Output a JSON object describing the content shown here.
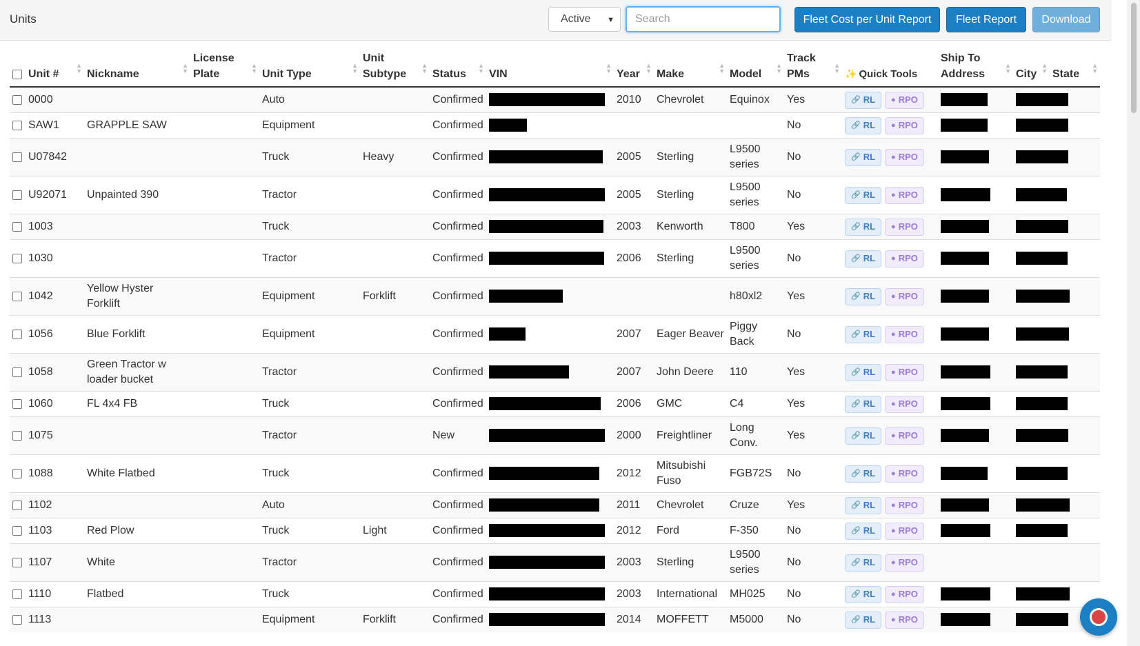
{
  "header": {
    "title": "Units",
    "status_filter": "Active",
    "search_placeholder": "Search",
    "buttons": {
      "fleet_cost": "Fleet Cost per Unit Report",
      "fleet_report": "Fleet Report",
      "download": "Download"
    }
  },
  "table": {
    "columns": {
      "unit": "Unit #",
      "nickname": "Nickname",
      "license_1": "License",
      "license_2": "Plate",
      "unit_type": "Unit Type",
      "subtype_1": "Unit",
      "subtype_2": "Subtype",
      "status": "Status",
      "vin": "VIN",
      "year": "Year",
      "make": "Make",
      "model": "Model",
      "track_1": "Track",
      "track_2": "PMs",
      "quick_tools": "Quick Tools",
      "ship_1": "Ship To",
      "ship_2": "Address",
      "city": "City",
      "state": "State"
    },
    "quick_tool_labels": {
      "rl": "RL",
      "rpo": "RPO"
    },
    "rows": [
      {
        "unit": "0000",
        "nickname": "",
        "unit_type": "Auto",
        "subtype": "",
        "status": "Confirmed",
        "vin_w": 168,
        "year": "2010",
        "make": "Chevrolet",
        "model": "Equinox",
        "track": "Yes",
        "tools": true,
        "ship_w": 68,
        "city_w": 76
      },
      {
        "unit": "SAW1",
        "nickname": "GRAPPLE SAW",
        "unit_type": "Equipment",
        "subtype": "",
        "status": "Confirmed",
        "vin_w": 55,
        "year": "",
        "make": "",
        "model": "",
        "track": "No",
        "tools": true,
        "ship_w": 68,
        "city_w": 76
      },
      {
        "unit": "U07842",
        "nickname": "",
        "unit_type": "Truck",
        "subtype": "Heavy",
        "status": "Confirmed",
        "vin_w": 165,
        "year": "2005",
        "make": "Sterling",
        "model": "L9500 series",
        "track": "No",
        "tools": true,
        "ship_w": 70,
        "city_w": 76
      },
      {
        "unit": "U92071",
        "nickname": "Unpainted 390",
        "unit_type": "Tractor",
        "subtype": "",
        "status": "Confirmed",
        "vin_w": 168,
        "year": "2005",
        "make": "Sterling",
        "model": "L9500 series",
        "track": "No",
        "tools": true,
        "ship_w": 72,
        "city_w": 74
      },
      {
        "unit": "1003",
        "nickname": "",
        "unit_type": "Truck",
        "subtype": "",
        "status": "Confirmed",
        "vin_w": 166,
        "year": "2003",
        "make": "Kenworth",
        "model": "T800",
        "track": "Yes",
        "tools": true,
        "ship_w": 70,
        "city_w": 76
      },
      {
        "unit": "1030",
        "nickname": "",
        "unit_type": "Tractor",
        "subtype": "",
        "status": "Confirmed",
        "vin_w": 167,
        "year": "2006",
        "make": "Sterling",
        "model": "L9500 series",
        "track": "No",
        "tools": true,
        "ship_w": 70,
        "city_w": 75
      },
      {
        "unit": "1042",
        "nickname": "Yellow Hyster Forklift",
        "unit_type": "Equipment",
        "subtype": "Forklift",
        "status": "Confirmed",
        "vin_w": 107,
        "year": "",
        "make": "",
        "model": "h80xl2",
        "track": "Yes",
        "tools": true,
        "ship_w": 70,
        "city_w": 78
      },
      {
        "unit": "1056",
        "nickname": "Blue Forklift",
        "unit_type": "Equipment",
        "subtype": "",
        "status": "Confirmed",
        "vin_w": 53,
        "year": "2007",
        "make": "Eager Beaver",
        "model": "Piggy Back",
        "track": "No",
        "tools": true,
        "ship_w": 70,
        "city_w": 77
      },
      {
        "unit": "1058",
        "nickname": "Green Tractor w loader bucket",
        "unit_type": "Tractor",
        "subtype": "",
        "status": "Confirmed",
        "vin_w": 116,
        "year": "2007",
        "make": "John Deere",
        "model": "110",
        "track": "Yes",
        "tools": true,
        "ship_w": 72,
        "city_w": 75
      },
      {
        "unit": "1060",
        "nickname": "FL 4x4 FB",
        "unit_type": "Truck",
        "subtype": "",
        "status": "Confirmed",
        "vin_w": 162,
        "year": "2006",
        "make": "GMC",
        "model": "C4",
        "track": "Yes",
        "tools": true,
        "ship_w": 72,
        "city_w": 75
      },
      {
        "unit": "1075",
        "nickname": "",
        "unit_type": "Tractor",
        "subtype": "",
        "status": "New",
        "vin_w": 168,
        "year": "2000",
        "make": "Freightliner",
        "model": "Long Conv.",
        "track": "Yes",
        "tools": true,
        "ship_w": 70,
        "city_w": 76
      },
      {
        "unit": "1088",
        "nickname": "White Flatbed",
        "unit_type": "Truck",
        "subtype": "",
        "status": "Confirmed",
        "vin_w": 160,
        "year": "2012",
        "make": "Mitsubishi Fuso",
        "model": "FGB72S",
        "track": "No",
        "tools": true,
        "ship_w": 68,
        "city_w": 75
      },
      {
        "unit": "1102",
        "nickname": "",
        "unit_type": "Auto",
        "subtype": "",
        "status": "Confirmed",
        "vin_w": 160,
        "year": "2011",
        "make": "Chevrolet",
        "model": "Cruze",
        "track": "Yes",
        "tools": true,
        "ship_w": 70,
        "city_w": 78
      },
      {
        "unit": "1103",
        "nickname": "Red Plow",
        "unit_type": "Truck",
        "subtype": "Light",
        "status": "Confirmed",
        "vin_w": 168,
        "year": "2012",
        "make": "Ford",
        "model": "F-350",
        "track": "No",
        "tools": true,
        "ship_w": 72,
        "city_w": 75
      },
      {
        "unit": "1107",
        "nickname": "White",
        "unit_type": "Tractor",
        "subtype": "",
        "status": "Confirmed",
        "vin_w": 168,
        "year": "2003",
        "make": "Sterling",
        "model": "L9500 series",
        "track": "No",
        "tools": true,
        "ship_w": 0,
        "city_w": 0
      },
      {
        "unit": "1110",
        "nickname": "Flatbed",
        "unit_type": "Truck",
        "subtype": "",
        "status": "Confirmed",
        "vin_w": 168,
        "year": "2003",
        "make": "International",
        "model": "MH025",
        "track": "No",
        "tools": true,
        "ship_w": 72,
        "city_w": 78
      },
      {
        "unit": "1113",
        "nickname": "",
        "unit_type": "Equipment",
        "subtype": "Forklift",
        "status": "Confirmed",
        "vin_w": 168,
        "year": "2014",
        "make": "MOFFETT",
        "model": "M5000",
        "track": "No",
        "tools": true,
        "ship_w": 72,
        "city_w": 76
      }
    ]
  }
}
